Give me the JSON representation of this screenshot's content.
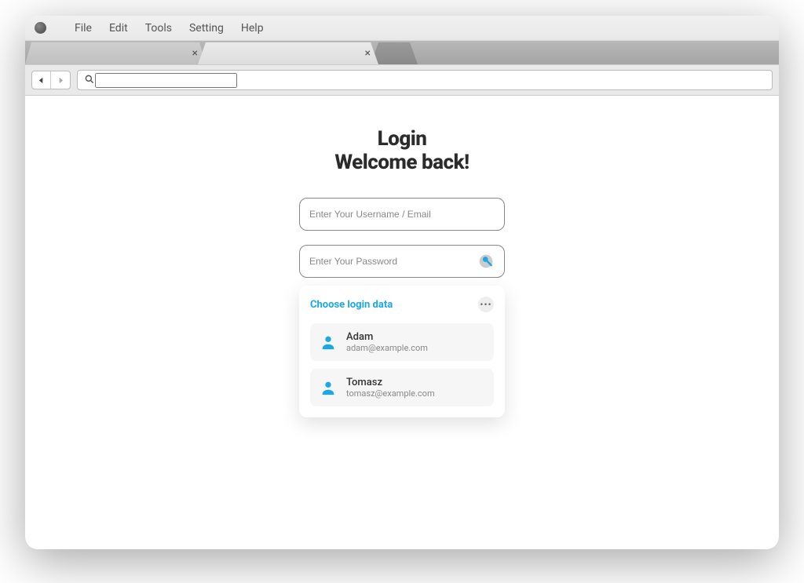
{
  "menubar": {
    "items": [
      "File",
      "Edit",
      "Tools",
      "Setting",
      "Help"
    ]
  },
  "tabs": {
    "tab1_close": "×",
    "tab2_close": "×"
  },
  "addressbar": {
    "placeholder": ""
  },
  "login": {
    "title": "Login",
    "subtitle": "Welcome back!",
    "username_placeholder": "Enter Your Username / Email",
    "password_placeholder": "Enter Your Password"
  },
  "autofill": {
    "title": "Choose login data",
    "more": "•••",
    "items": [
      {
        "name": "Adam",
        "email": "adam@example.com"
      },
      {
        "name": "Tomasz",
        "email": "tomasz@example.com"
      }
    ]
  }
}
